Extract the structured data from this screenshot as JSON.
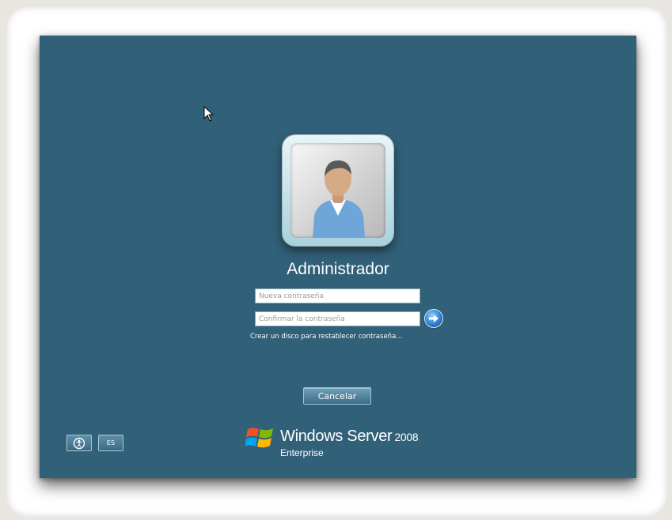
{
  "user": {
    "name": "Administrador"
  },
  "form": {
    "new_password_placeholder": "Nueva contraseña",
    "confirm_password_placeholder": "Confirmar la contraseña",
    "reset_disk_link": "Crear un disco para restablecer contraseña..."
  },
  "buttons": {
    "cancel": "Cancelar",
    "language": "ES"
  },
  "branding": {
    "product": "Windows Server",
    "version": "2008",
    "edition": "Enterprise"
  },
  "icons": {
    "submit": "arrow-right-icon",
    "ease_of_access": "ease-of-access-icon",
    "user_tile": "user-avatar-icon",
    "logo": "windows-flag-icon",
    "cursor": "mouse-pointer-icon"
  },
  "colors": {
    "background": "#316079",
    "accent": "#2d7fd0"
  }
}
